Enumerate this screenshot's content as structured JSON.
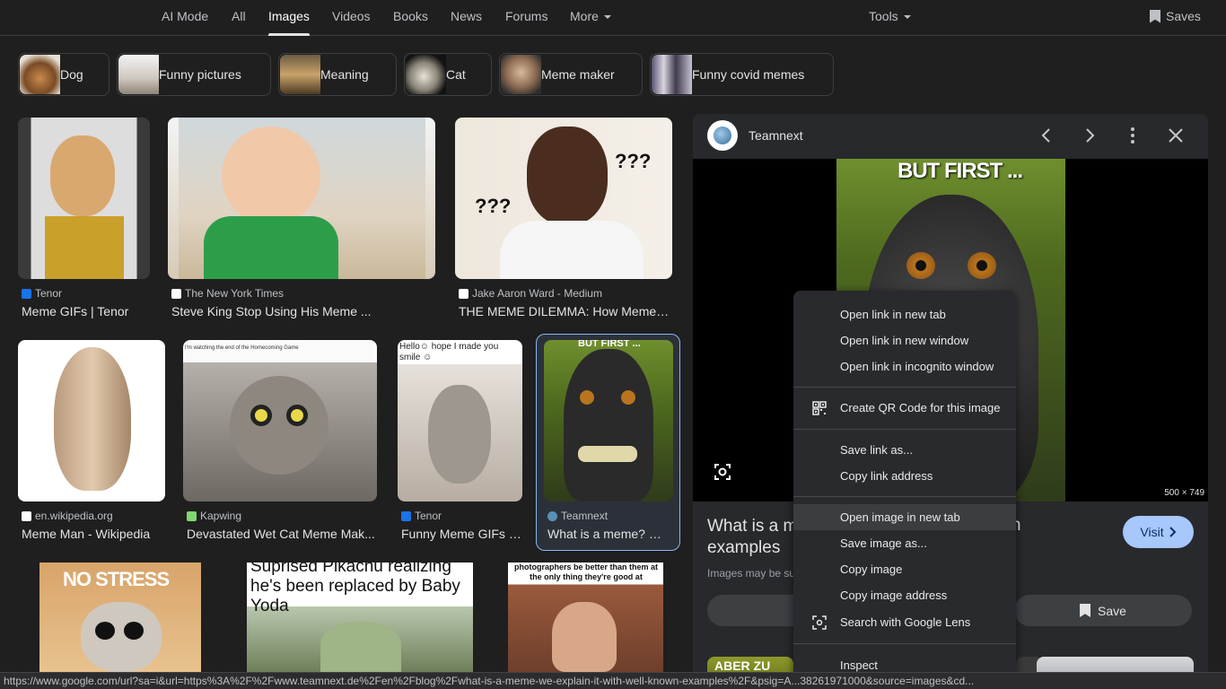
{
  "nav": {
    "tabs": [
      "AI Mode",
      "All",
      "Images",
      "Videos",
      "Books",
      "News",
      "Forums",
      "More"
    ],
    "tools": "Tools",
    "saves": "Saves"
  },
  "chips": [
    "Dog",
    "Funny pictures",
    "Meaning",
    "Cat",
    "Meme maker",
    "Funny covid memes"
  ],
  "results": [
    {
      "source": "Tenor",
      "caption": "Meme GIFs | Tenor"
    },
    {
      "source": "The New York Times",
      "caption": "Steve King Stop Using His Meme ..."
    },
    {
      "source": "Jake Aaron Ward - Medium",
      "caption": "THE MEME DILEMMA: How Memes ..."
    },
    {
      "source": "en.wikipedia.org",
      "caption": "Meme Man - Wikipedia"
    },
    {
      "source": "Kapwing",
      "caption": "Devastated Wet Cat Meme Mak..."
    },
    {
      "source": "Tenor",
      "caption": "Funny Meme GIFs | ..."
    },
    {
      "source": "Teamnext",
      "caption": "What is a meme? W..."
    }
  ],
  "image_texts": {
    "nicky": "???",
    "nicky2": "???",
    "donkey": "Hello☺ hope I made you smile ☺",
    "cat_caption": "I'm watching the end of the Homecoming Game",
    "monkey": "BUT FIRST ...",
    "nostress": "NO STRESS",
    "pikachu": "Suprised Pikachu realizing he's been replaced by Baby Yoda",
    "photog": "photographers be better than them at the only thing they're good at"
  },
  "panel": {
    "site": "Teamnext",
    "title_left": "What is a me",
    "title_right": "nown",
    "title_line2": "examples",
    "note": "Images may be su",
    "visit": "Visit",
    "save": "Save",
    "dims": "500 × 749",
    "related1": "ABER ZU"
  },
  "context_menu": {
    "items": [
      "Open link in new tab",
      "Open link in new window",
      "Open link in incognito window",
      "Create QR Code for this image",
      "Save link as...",
      "Copy link address",
      "Open image in new tab",
      "Save image as...",
      "Copy image",
      "Copy image address",
      "Search with Google Lens",
      "Inspect"
    ]
  },
  "status_url": "https://www.google.com/url?sa=i&url=https%3A%2F%2Fwww.teamnext.de%2Fen%2Fblog%2Fwhat-is-a-meme-we-explain-it-with-well-known-examples%2F&psig=A...38261971000&source=images&cd..."
}
